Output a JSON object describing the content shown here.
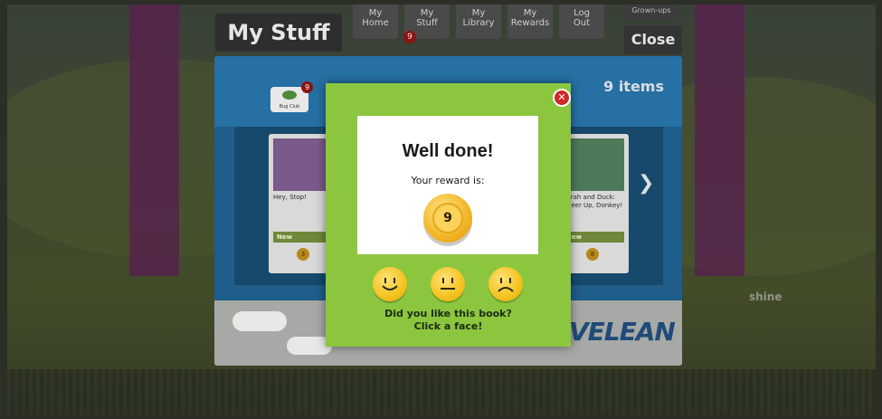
{
  "header": {
    "title": "My Stuff",
    "nav": [
      {
        "label_line1": "My",
        "label_line2": "Home"
      },
      {
        "label_line1": "My",
        "label_line2": "Stuff"
      },
      {
        "label_line1": "My",
        "label_line2": "Library"
      },
      {
        "label_line1": "My",
        "label_line2": "Rewards"
      },
      {
        "label_line1": "Log",
        "label_line2": "Out"
      }
    ],
    "stuff_badge": "9",
    "grownups_label": "Grown-ups",
    "close_label": "Close"
  },
  "panel": {
    "items_count": "9 items",
    "bugclub_label": "Bug Club",
    "bugclub_badge": "9",
    "cards": [
      {
        "title": "Hey, Stop!",
        "new_label": "New",
        "coin": "3"
      },
      {
        "title": "Sarah and Duck: Cheer Up, Donkey!",
        "new_label": "New",
        "coin": "8"
      }
    ],
    "brand_text": "VELEAN"
  },
  "modal": {
    "heading": "Well done!",
    "reward_label": "Your reward is:",
    "reward_value": "9",
    "question": "Did you like this book?",
    "instruction": "Click a face!",
    "faces": [
      "happy-face",
      "neutral-face",
      "sad-face"
    ]
  },
  "scene": {
    "side_text": "shine"
  },
  "colors": {
    "modal_green": "#8cc63f",
    "panel_blue": "#1f5d8a",
    "coin_gold": "#f2b524",
    "close_red": "#d02828"
  }
}
